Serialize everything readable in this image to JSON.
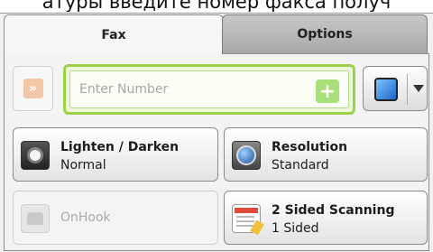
{
  "header_text": "атуры введите номер факса получ",
  "tabs": [
    {
      "label": "Fax",
      "active": true
    },
    {
      "label": "Options",
      "active": false
    }
  ],
  "number_input": {
    "placeholder": "Enter Number",
    "value": ""
  },
  "buttons": {
    "lighten_darken": {
      "label": "Lighten / Darken",
      "value": "Normal"
    },
    "resolution": {
      "label": "Resolution",
      "value": "Standard"
    },
    "onhook": {
      "label": "OnHook",
      "enabled": false
    },
    "two_sided": {
      "label": "2 Sided Scanning",
      "value": "1 Sided"
    }
  },
  "colors": {
    "accent_green": "#9bd24a",
    "tab_inactive": "#b5b5b5"
  },
  "icons": [
    "speed-dial-icon",
    "add-plus-icon",
    "address-book-icon",
    "dropdown-caret-icon",
    "brightness-icon",
    "resolution-icon",
    "phone-icon",
    "duplex-scan-icon"
  ]
}
